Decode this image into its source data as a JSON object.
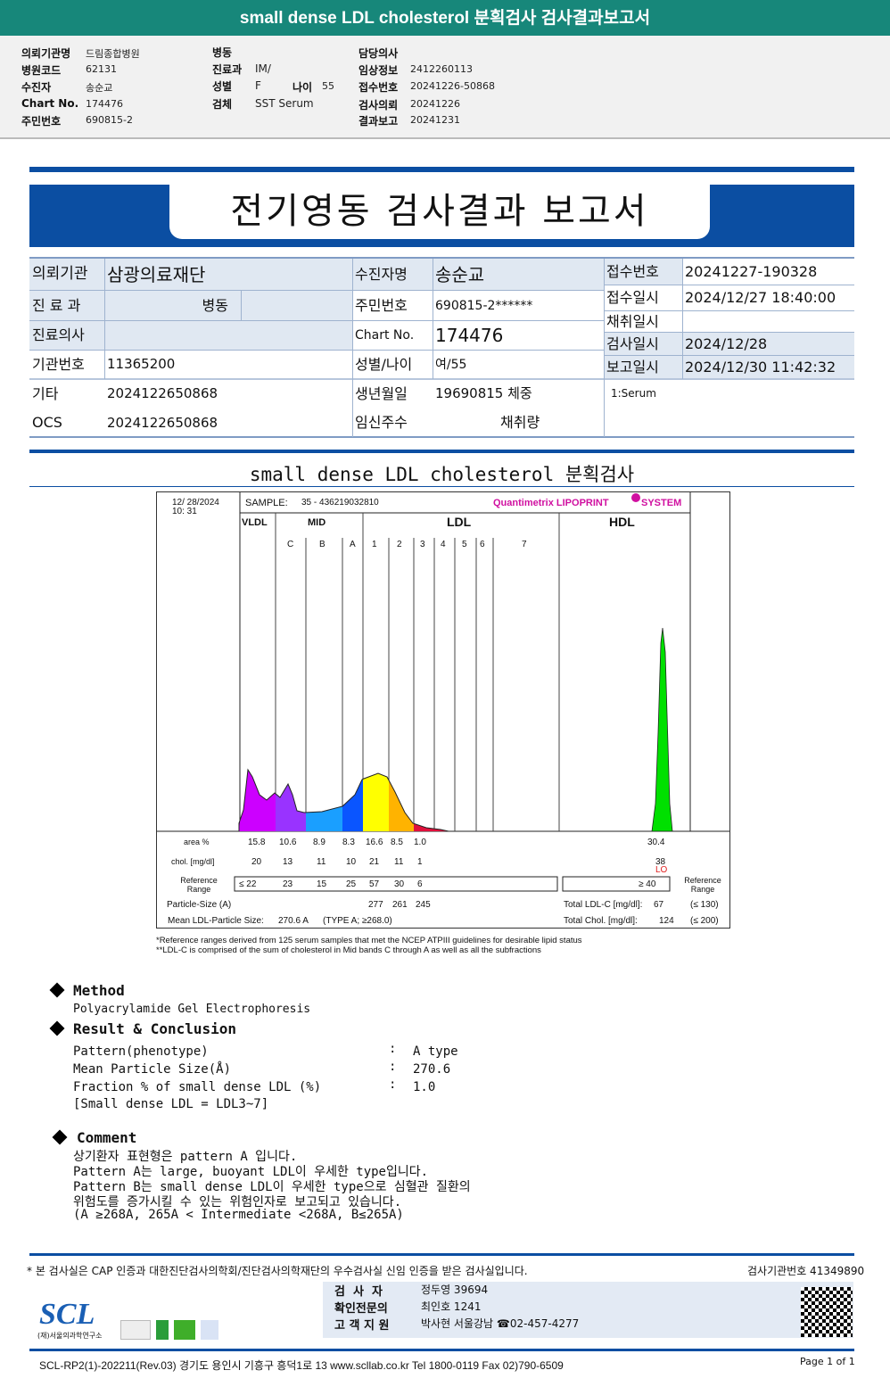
{
  "title": "small dense LDL cholesterol 분획검사 검사결과보고서",
  "info": {
    "c1": [
      [
        "의뢰기관명",
        "드림종합병원"
      ],
      [
        "병원코드",
        "62131"
      ],
      [
        "수진자",
        "송순교"
      ],
      [
        "Chart No.",
        "174476"
      ],
      [
        "주민번호",
        "690815-2"
      ]
    ],
    "c2": [
      [
        "병동",
        ""
      ],
      [
        "진료과",
        "IM/"
      ],
      [
        "성별",
        "F"
      ],
      [
        "검체",
        "SST Serum"
      ]
    ],
    "age_label": "나이",
    "age": "55",
    "c3": [
      [
        "담당의사",
        ""
      ],
      [
        "임상정보",
        "2412260113"
      ],
      [
        "접수번호",
        "20241226-50868"
      ],
      [
        "검사의뢰",
        "20241226"
      ],
      [
        "결과보고",
        "20241231"
      ]
    ]
  },
  "report_title": "전기영동 검사결과 보고서",
  "patient": {
    "inst_label": "의뢰기관",
    "inst": "삼광의료재단",
    "dept_label": "진 료 과",
    "ward": "병동",
    "doctor_label": "진료의사",
    "instno_label": "기관번호",
    "instno": "11365200",
    "etc_label": "기타",
    "etc": "2024122650868",
    "ocs_label": "OCS",
    "ocs": "2024122650868",
    "name_label": "수진자명",
    "name": "송순교",
    "rrn_label": "주민번호",
    "rrn": "690815-2******",
    "chart_label": "Chart No.",
    "chart": "174476",
    "sexage_label": "성별/나이",
    "sexage": "여/55",
    "dob_label": "생년월일",
    "dob": "19690815 체중",
    "preg_label": "임신주수",
    "amount_label": "채취량",
    "rcpt_label": "접수번호",
    "rcpt": "20241227-190328",
    "rcptdt_label": "접수일시",
    "rcptdt": "2024/12/27 18:40:00",
    "colldt_label": "채취일시",
    "testdt_label": "검사일시",
    "testdt": "2024/12/28",
    "repdt_label": "보고일시",
    "repdt": "2024/12/30 11:42:32",
    "specimen": "1:Serum"
  },
  "section_title": "small dense LDL cholesterol 분획검사",
  "chart_data": {
    "type": "area",
    "date": "12/ 28/2024",
    "time": "10: 31",
    "sample_label": "SAMPLE:",
    "sample": "35 - 436219032810",
    "brand": "Quantimetrix LIPOPRINT",
    "brand2": "SYSTEM",
    "groups": [
      "VLDL",
      "MID",
      "LDL",
      "HDL"
    ],
    "bands": [
      "C",
      "B",
      "A",
      "1",
      "2",
      "3",
      "4",
      "5",
      "6",
      "7"
    ],
    "band_colors": {
      "VLDL": "#cc00ff",
      "C": "#9933ff",
      "B": "#1a9fff",
      "A": "#0a55ff",
      "1": "#ffff00",
      "2": "#ffb300",
      "3": "#e0103c",
      "HDL": "#00e000"
    },
    "area_label": "area %",
    "area": [
      "15.8",
      "10.6",
      "8.9",
      "8.3",
      "16.6",
      "8.5",
      "1.0"
    ],
    "hdl_area": "30.4",
    "chol_label": "chol. [mg/dl]",
    "chol": [
      "20",
      "13",
      "11",
      "10",
      "21",
      "11",
      "1"
    ],
    "hdl_chol": "38",
    "hdl_flag": "LO",
    "ref_label": "Reference Range",
    "ref": [
      "≤ 22",
      "23",
      "15",
      "25",
      "57",
      "30",
      "6"
    ],
    "hdl_ref": "≥  40",
    "ps_label": "Particle-Size (A)",
    "ps": [
      "277",
      "261",
      "245"
    ],
    "mean_label": "Mean LDL-Particle Size:",
    "mean": "270.6  A",
    "mean_type": "(TYPE A; ≥268.0)",
    "tldl_label": "Total LDL-C [mg/dl]:",
    "tldl": "67",
    "tldl_ref": "(≤ 130)",
    "tchol_label": "Total Chol. [mg/dl]:",
    "tchol": "124",
    "tchol_ref": "(≤ 200)",
    "foot1": "*Reference ranges derived from 125 serum samples that met the NCEP ATPIII guidelines for desirable lipid status",
    "foot2": "**LDL-C is comprised of the sum of cholesterol in Mid bands C through A as well as all the subfractions"
  },
  "method": {
    "title": "Method",
    "text": "Polyacrylamide Gel Electrophoresis"
  },
  "result": {
    "title": "Result & Conclusion",
    "rows": [
      [
        "Pattern(phenotype)",
        "A type"
      ],
      [
        "Mean Particle Size(Å)",
        "270.6"
      ],
      [
        "Fraction % of small dense LDL (%)",
        "1.0"
      ]
    ],
    "note": "[Small dense LDL = LDL3~7]",
    "sep": ":"
  },
  "comment": {
    "title": "Comment",
    "lines": [
      "상기환자 표현형은 pattern A 입니다.",
      "Pattern A는 large, buoyant LDL이 우세한 type입니다.",
      "Pattern B는 small dense LDL이 우세한 type으로 심혈관 질환의",
      "위험도를 증가시킬 수 있는 위험인자로 보고되고 있습니다.",
      "(A ≥268A, 265A < Intermediate <268A, B≤265A)"
    ]
  },
  "footer": {
    "cert": "* 본 검사실은 CAP 인증과 대한진단검사의학회/진단검사의학재단의 우수검사실 신임 인증을 받은 검사실입니다.",
    "labno": "검사기관번호 41349890",
    "staff": [
      [
        "검  사  자",
        "정두영 39694"
      ],
      [
        "확인전문의",
        "최인호 1241"
      ],
      [
        "고 객 지 원",
        "박사현 서울강남 ☎02-457-4277"
      ]
    ],
    "logo": "SCL",
    "logo_sub": "(재)서울의과학연구소",
    "address": "SCL-RP2(1)-202211(Rev.03) 경기도 용인시 기흥구 흥덕1로 13  www.scllab.co.kr  Tel 1800-0119   Fax 02)790-6509",
    "page": "Page 1 of 1"
  }
}
